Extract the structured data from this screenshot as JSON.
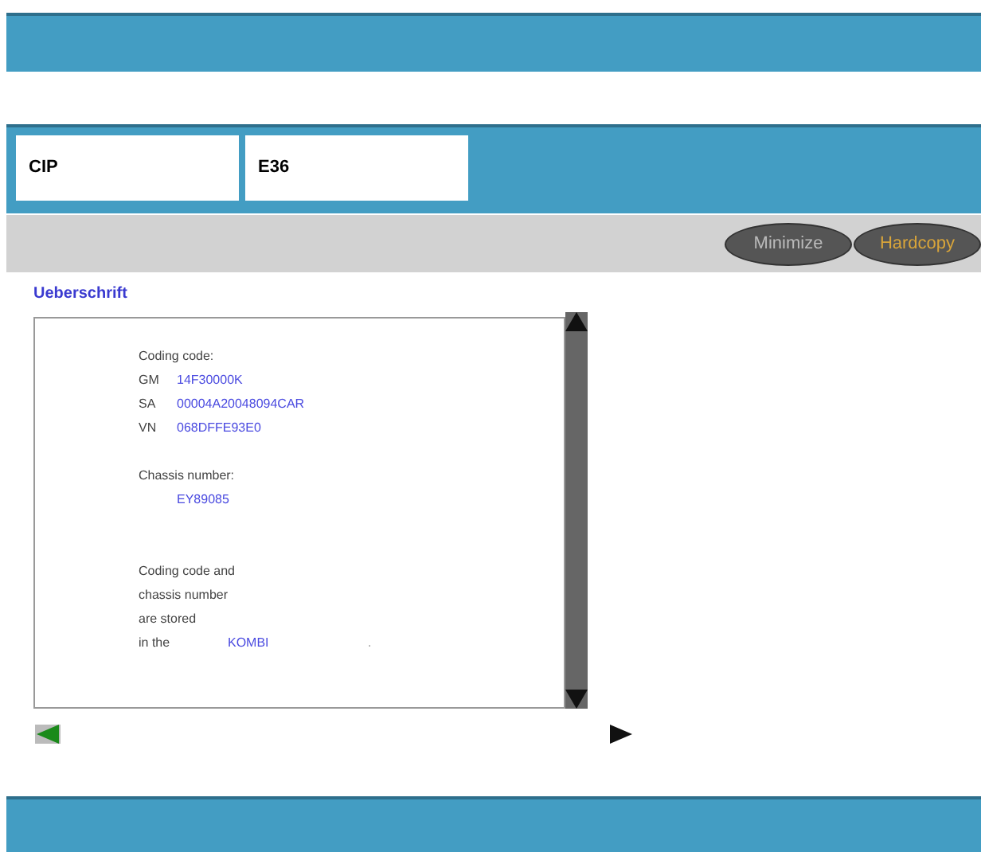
{
  "header_fields": [
    "CIP",
    "E36"
  ],
  "buttons": [
    {
      "label": "Minimize",
      "highlighted": false
    },
    {
      "label": "Hardcopy",
      "highlighted": true
    }
  ],
  "heading": "Ueberschrift",
  "content": [
    {
      "kind": "label",
      "text": "Coding code:"
    },
    {
      "kind": "pair",
      "key": "GM",
      "value": "14F30000K"
    },
    {
      "kind": "pair",
      "key": "SA",
      "value": "00004A20048094CAR"
    },
    {
      "kind": "pair",
      "key": "VN",
      "value": "068DFFE93E0"
    },
    {
      "kind": "gap"
    },
    {
      "kind": "label",
      "text": "Chassis number:"
    },
    {
      "kind": "indented",
      "value": "EY89085"
    },
    {
      "kind": "gap"
    },
    {
      "kind": "gap"
    },
    {
      "kind": "label",
      "text": "Coding code and"
    },
    {
      "kind": "label",
      "text": "chassis number"
    },
    {
      "kind": "label",
      "text": "are stored"
    },
    {
      "kind": "stored",
      "key": "in the",
      "value": "KOMBI",
      "trail": "."
    }
  ]
}
